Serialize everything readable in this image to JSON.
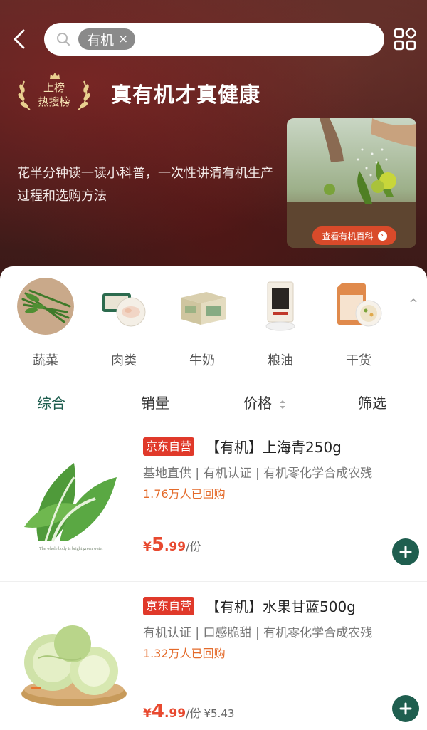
{
  "search": {
    "tag": "有机",
    "tag_close": "×"
  },
  "hero": {
    "badge_line1": "上榜",
    "badge_line2": "热搜榜",
    "title": "真有机才真健康",
    "description": "花半分钟读一读小科普，一次性讲清有机生产过程和选购方法",
    "card_button": "查看有机百科",
    "card_button_arrow": "›"
  },
  "categories": [
    {
      "label": "蔬菜"
    },
    {
      "label": "肉类"
    },
    {
      "label": "牛奶"
    },
    {
      "label": "粮油"
    },
    {
      "label": "干货"
    }
  ],
  "sort_tabs": [
    {
      "label": "综合",
      "active": true
    },
    {
      "label": "销量"
    },
    {
      "label": "价格"
    },
    {
      "label": "筛选"
    }
  ],
  "products": [
    {
      "badge": "京东自营",
      "title": "【有机】上海青250g",
      "tags": "基地直供 | 有机认证 | 有机零化学合成农残",
      "sold": "1.76万人已回购",
      "price_symbol": "¥",
      "price_int": "5",
      "price_dec": ".99",
      "unit": "/份",
      "orig_price": "",
      "image_caption": "The whole body is bright green water"
    },
    {
      "badge": "京东自营",
      "title": "【有机】水果甘蓝500g",
      "tags": "有机认证 | 口感脆甜 | 有机零化学合成农残",
      "sold": "1.32万人已回购",
      "price_symbol": "¥",
      "price_int": "4",
      "price_dec": ".99",
      "unit": "/份",
      "orig_price": "¥5.43"
    }
  ],
  "colors": {
    "accent_green": "#1f5e4f",
    "price_red": "#e8492f",
    "badge_red": "#e0392a",
    "sold_orange": "#e46b2b"
  }
}
